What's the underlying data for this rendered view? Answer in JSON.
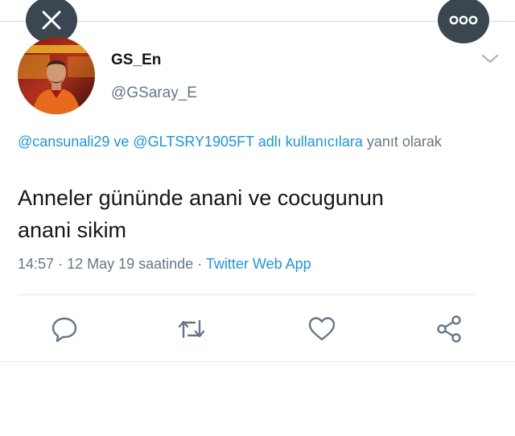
{
  "overlay": {
    "close_icon": "close-icon",
    "more_icon": "more-icon"
  },
  "tweet": {
    "display_name": "GS_En",
    "handle": "@GSaray_E",
    "reply_context": {
      "mention_1": "@cansunali29",
      "connector": "ve",
      "mention_2": "@GLTSRY1905FT",
      "suffix_link": "adlı kullanıcılara",
      "suffix_text": "yanıt olarak"
    },
    "text_line_1": "Anneler gününde anani ve cocugunun",
    "text_line_2": "anani sikim",
    "time": "14:57",
    "separator": "·",
    "date_text": "12 May 19 saatinde",
    "source": "Twitter Web App"
  },
  "actions": {
    "reply_icon": "reply-icon",
    "retweet_icon": "retweet-icon",
    "like_icon": "heart-icon",
    "share_icon": "share-icon"
  },
  "colors": {
    "link": "#1b95e0",
    "secondary_text": "#657786",
    "primary_text": "#14171a",
    "overlay_button": "#3a4750",
    "divider": "#e1e8ed"
  }
}
